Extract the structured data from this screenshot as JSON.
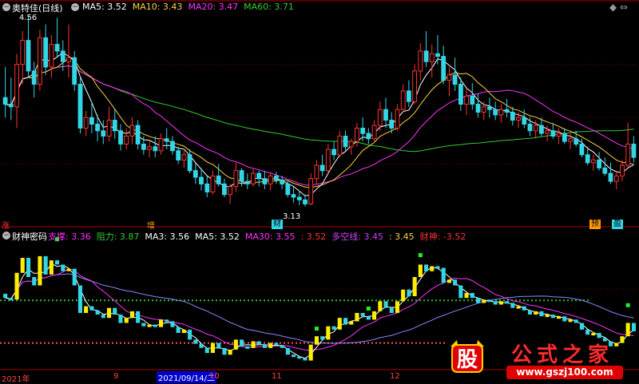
{
  "colors": {
    "up": "#ff3333",
    "down": "#33d6e6",
    "ma5": "#ffffff",
    "ma10": "#ffd23f",
    "ma20": "#ff33ff",
    "ma60": "#33cc33",
    "grid": "#7a0000",
    "axis": "#aa0000",
    "dotted_green": "#22cc22",
    "dotted_red": "#ff5555"
  },
  "upper_pane": {
    "title": "奥特佳(日线)",
    "legend": [
      {
        "label": "MA5: 3.52",
        "color": "#ffffff"
      },
      {
        "label": "MA10: 3.43",
        "color": "#ffd23f"
      },
      {
        "label": "MA20: 3.47",
        "color": "#ff33ff"
      },
      {
        "label": "MA60: 3.71",
        "color": "#33cc33"
      }
    ],
    "high_label": "4.56",
    "low_label": "3.13",
    "markers": {
      "zhang": "涨",
      "zeng": "增",
      "cai": "财",
      "yu": "预",
      "ying": "盈"
    },
    "corner_icons": "◆ ⇔"
  },
  "lower_pane": {
    "title": "财神密码",
    "legend": [
      {
        "label": "支撑: 3.36",
        "color": "#ff33ff"
      },
      {
        "label": "阻力: 3.87",
        "color": "#33cc33"
      },
      {
        "label": "MA3: 3.56",
        "color": "#ffffff"
      },
      {
        "label": "MA5: 3.52",
        "color": "#ffffff"
      },
      {
        "label": "MA30: 3.55",
        "color": "#ff33ff"
      },
      {
        "label": ": 3.52",
        "color": "#ff3333"
      },
      {
        "label": "多空线: 3.45",
        "color": "#cc44ff"
      },
      {
        "label": ": 3.45",
        "color": "#ffd23f"
      },
      {
        "label": "财神: -3.52",
        "color": "#ff3333"
      }
    ]
  },
  "date_axis": [
    "2021年",
    "9",
    "2021/09/14/二",
    "10",
    "11",
    "12"
  ],
  "watermark": {
    "text": "公式之家",
    "url": "www.gszj100.com",
    "logo_char": "股"
  },
  "chart_data": {
    "type": "candlestick",
    "note_units": "price in CNY",
    "ylim": [
      3.05,
      4.6
    ],
    "candles": [
      [
        3.95,
        4.18,
        3.8,
        3.9
      ],
      [
        3.9,
        4.1,
        3.78,
        3.88
      ],
      [
        3.88,
        4.28,
        3.72,
        4.2
      ],
      [
        4.2,
        4.45,
        4.05,
        4.38
      ],
      [
        4.38,
        4.56,
        4.1,
        4.15
      ],
      [
        4.15,
        4.22,
        3.95,
        4.05
      ],
      [
        4.05,
        4.46,
        4.0,
        4.4
      ],
      [
        4.4,
        4.5,
        4.12,
        4.18
      ],
      [
        4.18,
        4.42,
        4.1,
        4.35
      ],
      [
        4.35,
        4.55,
        4.25,
        4.3
      ],
      [
        4.3,
        4.38,
        4.15,
        4.22
      ],
      [
        4.22,
        4.5,
        4.1,
        4.25
      ],
      [
        4.25,
        4.3,
        4.0,
        4.05
      ],
      [
        4.05,
        4.1,
        3.68,
        3.72
      ],
      [
        3.72,
        3.85,
        3.66,
        3.8
      ],
      [
        3.8,
        3.92,
        3.68,
        3.75
      ],
      [
        3.75,
        3.82,
        3.62,
        3.7
      ],
      [
        3.7,
        3.78,
        3.6,
        3.66
      ],
      [
        3.66,
        3.88,
        3.62,
        3.78
      ],
      [
        3.78,
        3.86,
        3.64,
        3.7
      ],
      [
        3.7,
        3.75,
        3.55,
        3.6
      ],
      [
        3.6,
        3.72,
        3.56,
        3.66
      ],
      [
        3.66,
        3.8,
        3.6,
        3.74
      ],
      [
        3.74,
        3.78,
        3.56,
        3.6
      ],
      [
        3.6,
        3.66,
        3.52,
        3.56
      ],
      [
        3.56,
        3.62,
        3.5,
        3.58
      ],
      [
        3.58,
        3.66,
        3.5,
        3.55
      ],
      [
        3.55,
        3.68,
        3.52,
        3.64
      ],
      [
        3.64,
        3.72,
        3.56,
        3.62
      ],
      [
        3.62,
        3.66,
        3.52,
        3.55
      ],
      [
        3.55,
        3.58,
        3.45,
        3.48
      ],
      [
        3.48,
        3.55,
        3.42,
        3.52
      ],
      [
        3.52,
        3.56,
        3.38,
        3.4
      ],
      [
        3.4,
        3.46,
        3.3,
        3.35
      ],
      [
        3.35,
        3.42,
        3.25,
        3.3
      ],
      [
        3.3,
        3.36,
        3.2,
        3.24
      ],
      [
        3.24,
        3.4,
        3.22,
        3.36
      ],
      [
        3.36,
        3.45,
        3.28,
        3.3
      ],
      [
        3.3,
        3.34,
        3.2,
        3.22
      ],
      [
        3.22,
        3.3,
        3.15,
        3.28
      ],
      [
        3.28,
        3.46,
        3.24,
        3.4
      ],
      [
        3.4,
        3.42,
        3.28,
        3.32
      ],
      [
        3.32,
        3.38,
        3.26,
        3.3
      ],
      [
        3.3,
        3.42,
        3.28,
        3.38
      ],
      [
        3.38,
        3.4,
        3.28,
        3.34
      ],
      [
        3.34,
        3.4,
        3.26,
        3.3
      ],
      [
        3.3,
        3.38,
        3.25,
        3.36
      ],
      [
        3.36,
        3.39,
        3.3,
        3.33
      ],
      [
        3.33,
        3.36,
        3.26,
        3.3
      ],
      [
        3.3,
        3.32,
        3.2,
        3.22
      ],
      [
        3.22,
        3.28,
        3.16,
        3.2
      ],
      [
        3.2,
        3.24,
        3.14,
        3.18
      ],
      [
        3.18,
        3.22,
        3.13,
        3.15
      ],
      [
        3.15,
        3.38,
        3.14,
        3.34
      ],
      [
        3.34,
        3.48,
        3.3,
        3.44
      ],
      [
        3.44,
        3.52,
        3.36,
        3.4
      ],
      [
        3.4,
        3.6,
        3.38,
        3.56
      ],
      [
        3.56,
        3.62,
        3.48,
        3.52
      ],
      [
        3.52,
        3.7,
        3.5,
        3.66
      ],
      [
        3.66,
        3.7,
        3.55,
        3.58
      ],
      [
        3.58,
        3.64,
        3.52,
        3.62
      ],
      [
        3.62,
        3.76,
        3.58,
        3.72
      ],
      [
        3.72,
        3.8,
        3.62,
        3.68
      ],
      [
        3.68,
        3.72,
        3.6,
        3.64
      ],
      [
        3.64,
        3.78,
        3.62,
        3.74
      ],
      [
        3.74,
        3.92,
        3.7,
        3.86
      ],
      [
        3.86,
        3.95,
        3.72,
        3.78
      ],
      [
        3.78,
        3.84,
        3.68,
        3.72
      ],
      [
        3.72,
        3.9,
        3.7,
        3.86
      ],
      [
        3.86,
        4.05,
        3.84,
        4.0
      ],
      [
        4.0,
        4.08,
        3.88,
        3.92
      ],
      [
        3.92,
        4.2,
        3.9,
        4.15
      ],
      [
        4.15,
        4.36,
        4.08,
        4.3
      ],
      [
        4.3,
        4.45,
        4.18,
        4.22
      ],
      [
        4.22,
        4.35,
        4.1,
        4.28
      ],
      [
        4.28,
        4.42,
        4.2,
        4.26
      ],
      [
        4.26,
        4.34,
        4.05,
        4.08
      ],
      [
        4.08,
        4.18,
        3.96,
        4.12
      ],
      [
        4.12,
        4.25,
        4.0,
        4.05
      ],
      [
        4.05,
        4.1,
        3.85,
        3.9
      ],
      [
        3.9,
        4.02,
        3.82,
        3.96
      ],
      [
        3.96,
        4.06,
        3.86,
        3.9
      ],
      [
        3.9,
        3.98,
        3.8,
        3.84
      ],
      [
        3.84,
        3.92,
        3.78,
        3.88
      ],
      [
        3.88,
        3.95,
        3.8,
        3.86
      ],
      [
        3.86,
        3.92,
        3.78,
        3.82
      ],
      [
        3.82,
        3.9,
        3.76,
        3.86
      ],
      [
        3.86,
        3.94,
        3.8,
        3.84
      ],
      [
        3.84,
        3.88,
        3.74,
        3.78
      ],
      [
        3.78,
        3.84,
        3.72,
        3.8
      ],
      [
        3.8,
        3.86,
        3.72,
        3.75
      ],
      [
        3.75,
        3.8,
        3.66,
        3.7
      ],
      [
        3.7,
        3.78,
        3.64,
        3.74
      ],
      [
        3.74,
        3.8,
        3.66,
        3.68
      ],
      [
        3.68,
        3.74,
        3.62,
        3.7
      ],
      [
        3.7,
        3.76,
        3.64,
        3.66
      ],
      [
        3.66,
        3.72,
        3.6,
        3.68
      ],
      [
        3.68,
        3.72,
        3.6,
        3.62
      ],
      [
        3.62,
        3.68,
        3.56,
        3.64
      ],
      [
        3.64,
        3.7,
        3.58,
        3.6
      ],
      [
        3.6,
        3.64,
        3.5,
        3.52
      ],
      [
        3.52,
        3.58,
        3.44,
        3.46
      ],
      [
        3.46,
        3.52,
        3.4,
        3.48
      ],
      [
        3.48,
        3.54,
        3.4,
        3.42
      ],
      [
        3.42,
        3.5,
        3.36,
        3.38
      ],
      [
        3.38,
        3.46,
        3.3,
        3.32
      ],
      [
        3.32,
        3.4,
        3.26,
        3.36
      ],
      [
        3.36,
        3.48,
        3.32,
        3.44
      ],
      [
        3.44,
        3.76,
        3.42,
        3.6
      ],
      [
        3.6,
        3.66,
        3.46,
        3.5
      ]
    ]
  }
}
